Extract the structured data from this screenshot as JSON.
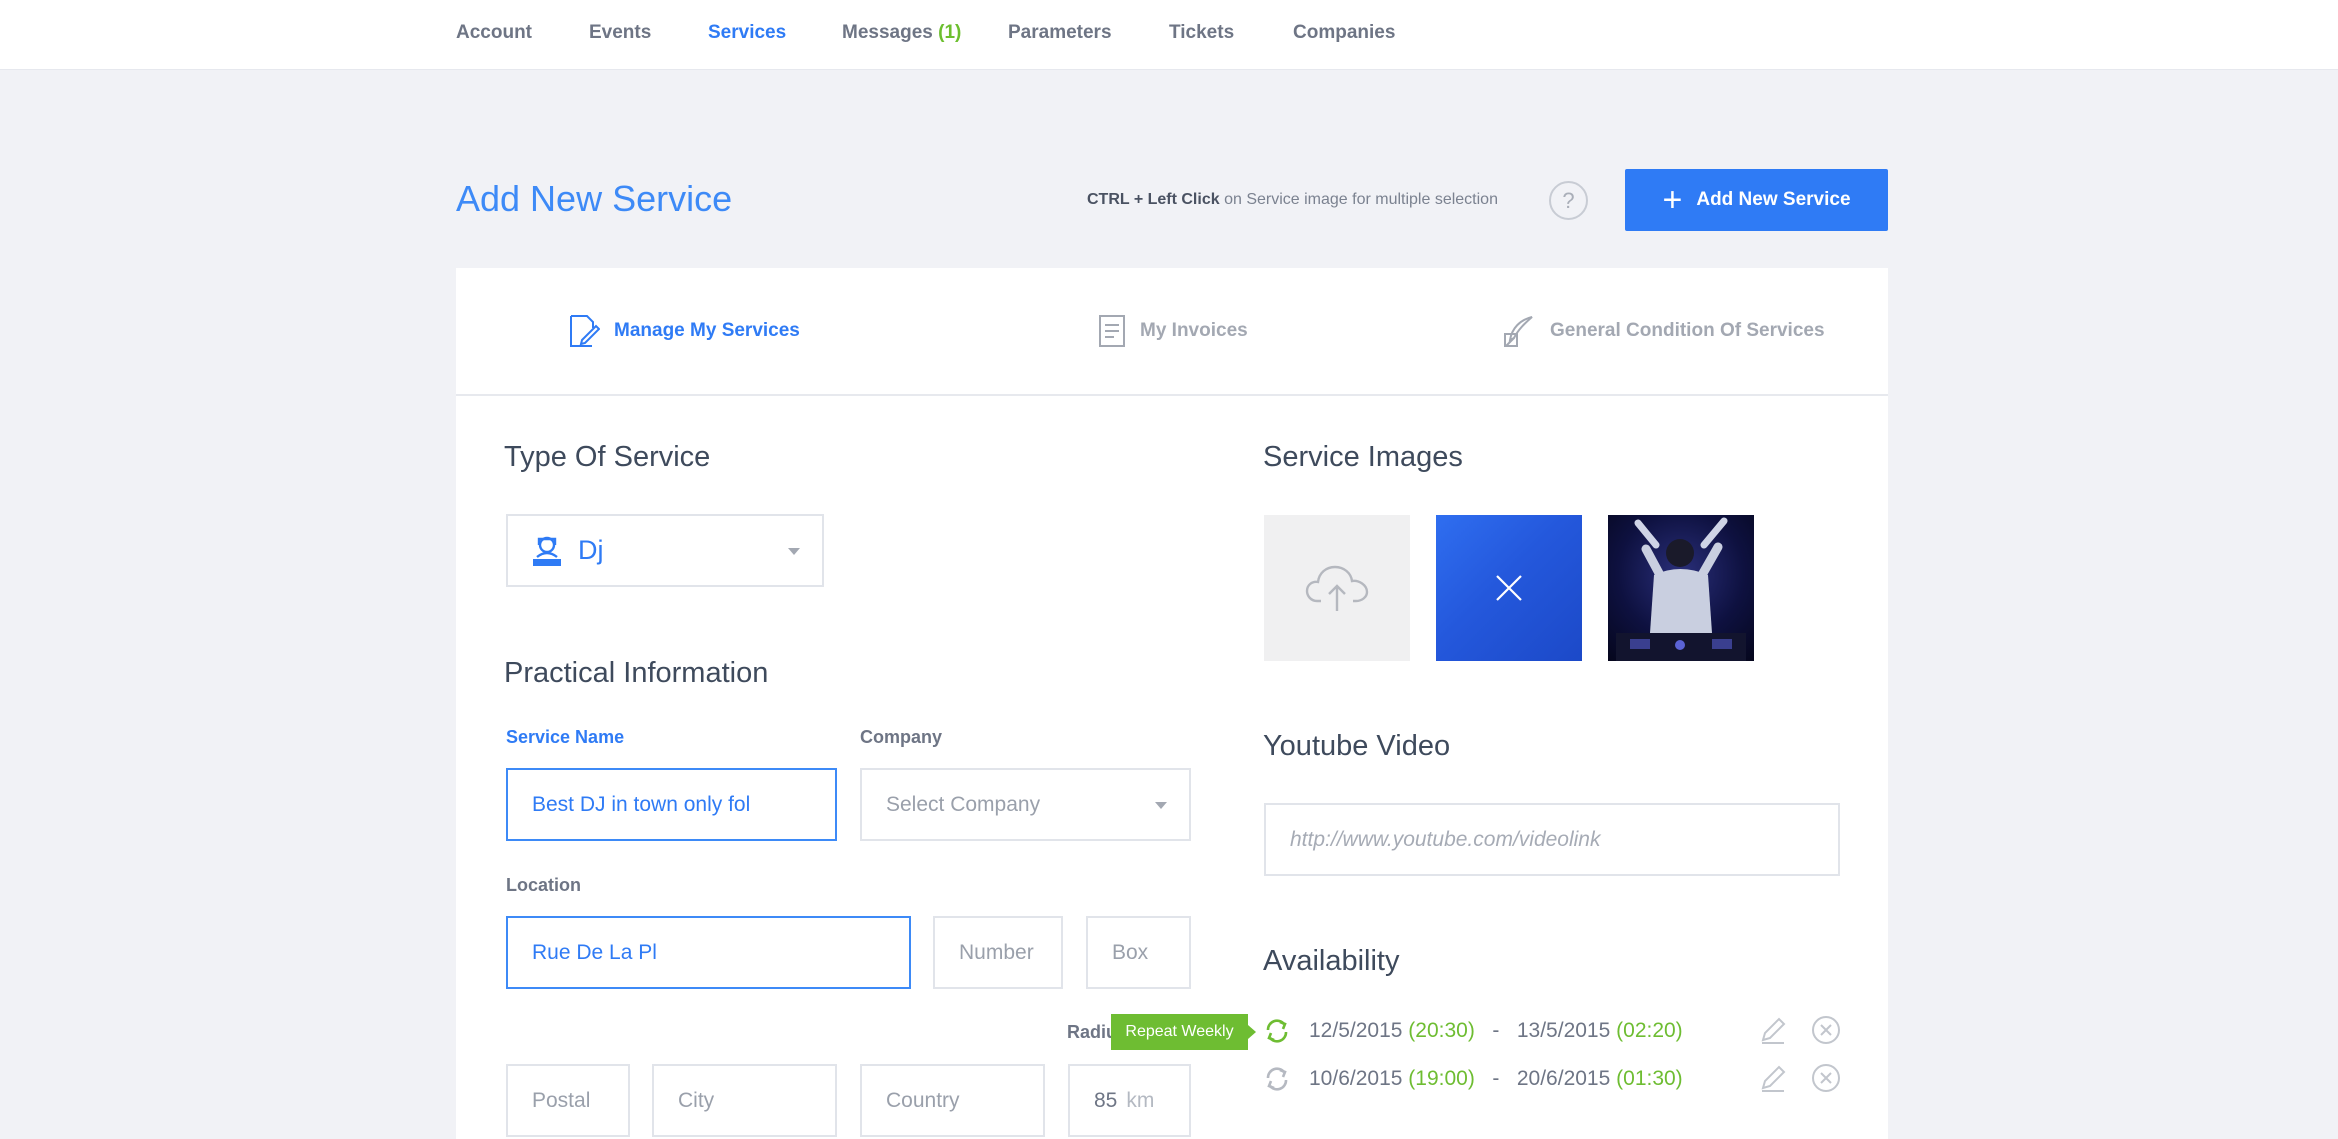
{
  "nav": {
    "items": [
      {
        "label": "Account"
      },
      {
        "label": "Events"
      },
      {
        "label": "Services"
      },
      {
        "label": "Messages",
        "badge": "(1)"
      },
      {
        "label": "Parameters"
      },
      {
        "label": "Tickets"
      },
      {
        "label": "Companies"
      }
    ],
    "active": "Services"
  },
  "header": {
    "title": "Add New Service",
    "hint_bold": "CTRL + Left Click",
    "hint_rest": " on Service image for multiple selection",
    "help_icon": "?",
    "add_button": "Add New Service"
  },
  "tabs": [
    {
      "label": "Manage My Services",
      "icon": "edit-document-icon",
      "active": true
    },
    {
      "label": "My Invoices",
      "icon": "invoice-icon",
      "active": false
    },
    {
      "label": "General Condition Of Services",
      "icon": "quill-icon",
      "active": false
    }
  ],
  "form": {
    "type_title": "Type Of Service",
    "type_value": "Dj",
    "practical_title": "Practical Information",
    "service_name_label": "Service Name",
    "service_name_value": "Best DJ in town only fol",
    "company_label": "Company",
    "company_placeholder": "Select Company",
    "location_label": "Location",
    "street_value": "Rue De La Pl",
    "number_placeholder": "Number",
    "box_placeholder": "Box",
    "radius_label": "Radius",
    "postal_placeholder": "Postal",
    "city_placeholder": "City",
    "country_placeholder": "Country",
    "radius_value": "85",
    "radius_unit": "km"
  },
  "images": {
    "title": "Service Images"
  },
  "youtube": {
    "title": "Youtube Video",
    "placeholder": "http://www.youtube.com/videolink"
  },
  "availability": {
    "title": "Availability",
    "tooltip": "Repeat Weekly",
    "rows": [
      {
        "start_date": "12/5/2015",
        "start_time": "(20:30)",
        "sep": "-",
        "end_date": "13/5/2015",
        "end_time": "(02:20)",
        "repeat_active": true
      },
      {
        "start_date": "10/6/2015",
        "start_time": "(19:00)",
        "sep": "-",
        "end_date": "20/6/2015",
        "end_time": "(01:30)",
        "repeat_active": false
      }
    ]
  },
  "colors": {
    "accent": "#2f7bf5",
    "green": "#6ebd32",
    "background": "#f1f2f6"
  }
}
